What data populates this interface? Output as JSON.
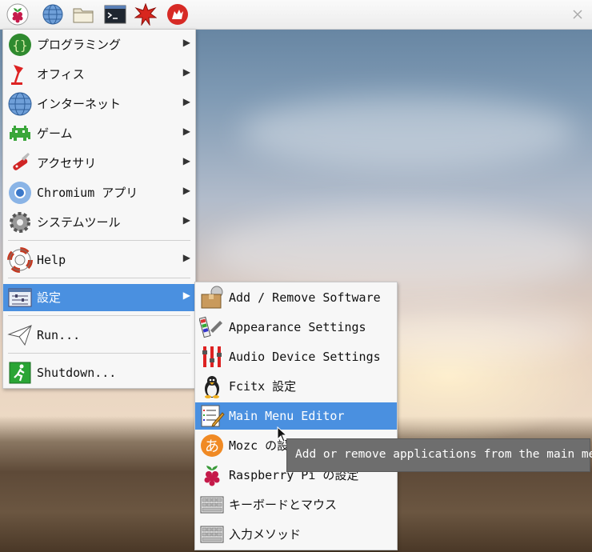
{
  "panel": {
    "icons": [
      "raspberry-icon",
      "globe-icon",
      "folder-icon",
      "terminal-icon",
      "burst-icon",
      "wolfram-icon"
    ]
  },
  "main_menu": {
    "items": [
      {
        "label": "プログラミング",
        "icon": "braces-icon"
      },
      {
        "label": "オフィス",
        "icon": "desk-lamp-icon"
      },
      {
        "label": "インターネット",
        "icon": "globe-icon"
      },
      {
        "label": "ゲーム",
        "icon": "space-invader-icon"
      },
      {
        "label": "アクセサリ",
        "icon": "knife-icon"
      },
      {
        "label": "Chromium アプリ",
        "icon": "chromium-icon"
      },
      {
        "label": "システムツール",
        "icon": "gear-icon"
      },
      {
        "label": "Help",
        "icon": "lifebuoy-icon"
      },
      {
        "label": "設定",
        "icon": "settings-panel-icon"
      },
      {
        "label": "Run...",
        "icon": "paper-plane-icon"
      },
      {
        "label": "Shutdown...",
        "icon": "exit-icon"
      }
    ]
  },
  "submenu": {
    "items": [
      {
        "label": "Add / Remove Software",
        "icon": "package-icon"
      },
      {
        "label": "Appearance Settings",
        "icon": "palette-icon"
      },
      {
        "label": "Audio Device Settings",
        "icon": "mixer-icon"
      },
      {
        "label": "Fcitx 設定",
        "icon": "penguin-icon"
      },
      {
        "label": "Main Menu Editor",
        "icon": "menu-editor-icon"
      },
      {
        "label": "Mozc の設定",
        "icon": "mozc-icon"
      },
      {
        "label": "Raspberry Pi の設定",
        "icon": "raspberry-icon"
      },
      {
        "label": "キーボードとマウス",
        "icon": "keyboard-icon"
      },
      {
        "label": "入力メソッド",
        "icon": "keyboard-icon"
      }
    ]
  },
  "tooltip": "Add or remove applications from the main menu",
  "colors": {
    "selection": "#4a90e0",
    "menu_bg": "#f7f7f7",
    "tooltip_bg": "#6e6e6e"
  }
}
